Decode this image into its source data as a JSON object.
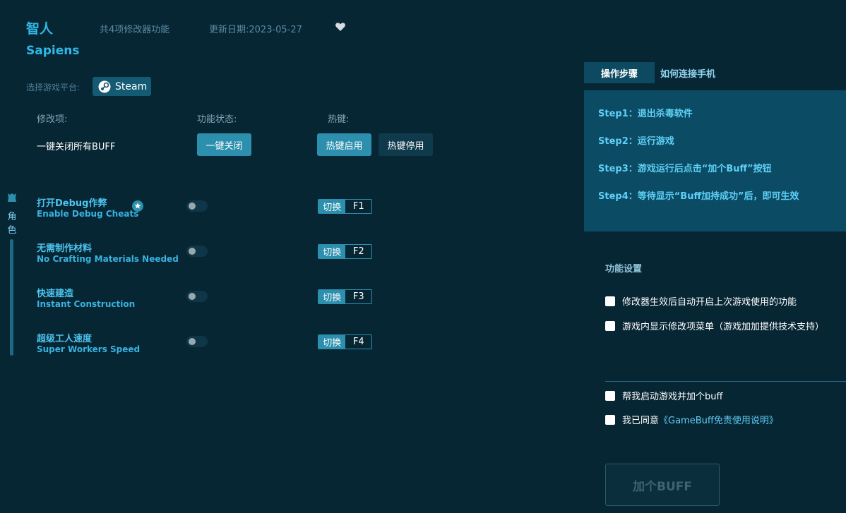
{
  "header": {
    "title_cn": "智人",
    "feature_count": "共4项修改器功能",
    "update_date": "更新日期:2023-05-27",
    "title_en": "Sapiens"
  },
  "platform": {
    "label": "选择游戏平台:",
    "selected": "Steam"
  },
  "columns": {
    "mod": "修改项:",
    "status": "功能状态:",
    "hotkey": "热键:"
  },
  "master": {
    "label": "一键关闭所有BUFF",
    "close_button": "一键关闭",
    "hotkey_enable": "热键启用",
    "hotkey_disable": "热键停用"
  },
  "sidebar": {
    "category": "角色"
  },
  "cheats": [
    {
      "name_cn": "打开Debug作弊",
      "name_en": "Enable Debug Cheats",
      "switch_label": "切换",
      "key": "F1",
      "enabled": false
    },
    {
      "name_cn": "无需制作材料",
      "name_en": "No Crafting Materials Needed",
      "switch_label": "切换",
      "key": "F2",
      "enabled": false
    },
    {
      "name_cn": "快速建造",
      "name_en": "Instant Construction",
      "switch_label": "切换",
      "key": "F3",
      "enabled": false
    },
    {
      "name_cn": "超级工人速度",
      "name_en": "Super Workers Speed",
      "switch_label": "切换",
      "key": "F4",
      "enabled": false
    }
  ],
  "right_panel": {
    "tab_steps": "操作步骤",
    "tab_phone": "如何连接手机",
    "steps": [
      "Step1：退出杀毒软件",
      "Step2：运行游戏",
      "Step3：游戏运行后点击“加个Buff”按钮",
      "Step4：等待显示“Buff加持成功”后，即可生效"
    ]
  },
  "settings": {
    "title": "功能设置",
    "option1": "修改器生效后自动开启上次游戏使用的功能",
    "option2": "游戏内显示修改项菜单（游戏加加提供技术支持）",
    "launch_option": "帮我启动游戏并加个buff",
    "agree_prefix": "我已同意",
    "agree_link": "《GameBuff免责使用说明》",
    "add_buff_button": "加个BUFF"
  },
  "colors": {
    "background": "#072634",
    "accent": "#2b8fad",
    "title": "#2fb8e6"
  }
}
